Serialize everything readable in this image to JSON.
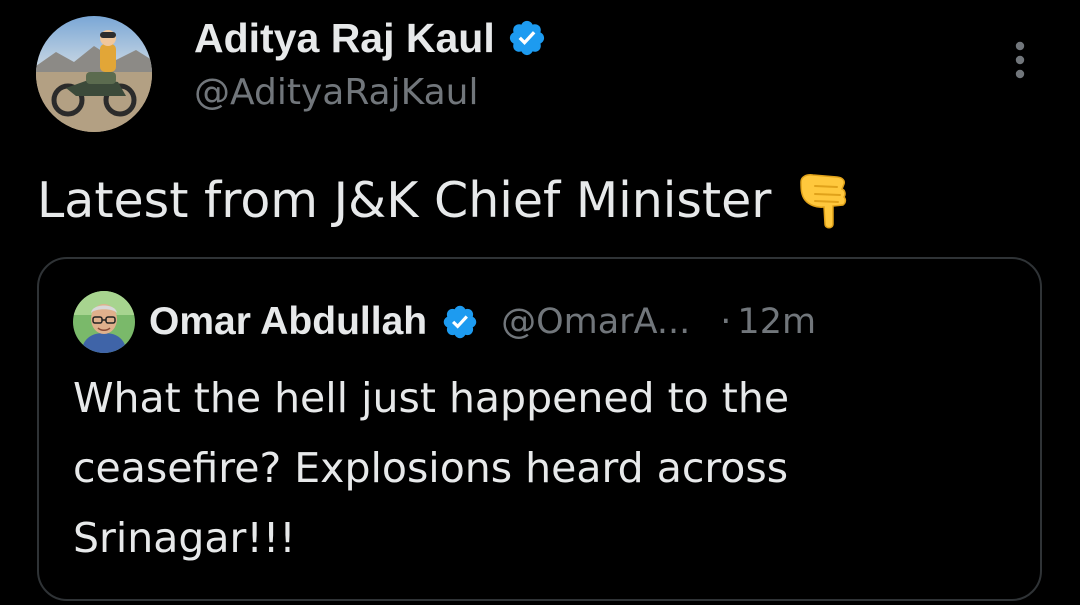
{
  "theme": {
    "background": "#000000",
    "text_primary": "#e7e9ea",
    "text_secondary": "#71767b",
    "border": "#2f3336",
    "verified_blue": "#1d9bf0"
  },
  "author": {
    "display_name": "Aditya Raj Kaul",
    "handle": "@AdityaRajKaul",
    "avatar_icon": "avatar-motorcycle-rider",
    "verified_icon": "verified-badge-icon"
  },
  "menu": {
    "icon": "more-vertical-icon"
  },
  "tweet": {
    "text": "Latest from J&K Chief Minister",
    "emoji": "backhand-index-pointing-down"
  },
  "quoted_tweet": {
    "display_name": "Omar Abdullah",
    "handle": "@OmarA...",
    "separator": "·",
    "time": "12m",
    "verified_icon": "verified-badge-icon",
    "avatar_icon": "avatar-man-glasses",
    "text_lines": [
      "What the hell just happened to the",
      "ceasefire? Explosions heard across",
      "Srinagar!!!"
    ]
  }
}
